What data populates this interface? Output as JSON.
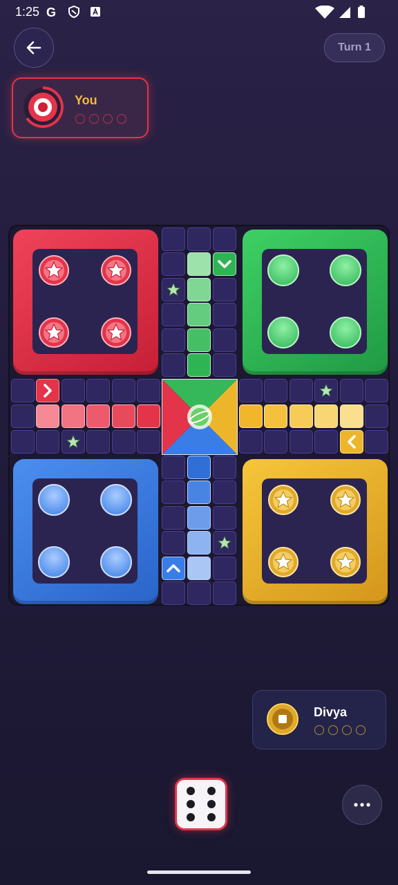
{
  "status_bar": {
    "time": "1:25",
    "g_label": "G"
  },
  "header": {
    "turn_label": "Turn 1"
  },
  "players": {
    "you": {
      "name": "You",
      "accent": "#e3344a",
      "name_color": "#f4b83c"
    },
    "divya": {
      "name": "Divya",
      "accent": "#e0a92a",
      "name_color": "#ffffff"
    }
  },
  "board": {
    "colors": {
      "red": "#e3344a",
      "green": "#2fb454",
      "blue": "#3a7de6",
      "yellow": "#edb62a",
      "track": "#2f2760"
    },
    "safe_icon": "star-icon",
    "arrows": [
      "arrow-right-icon",
      "arrow-down-icon",
      "arrow-left-icon",
      "arrow-up-icon"
    ],
    "center_icon": "planet-icon"
  },
  "dice": {
    "value": 6
  },
  "menu": {
    "icon": "more-horizontal-icon"
  }
}
